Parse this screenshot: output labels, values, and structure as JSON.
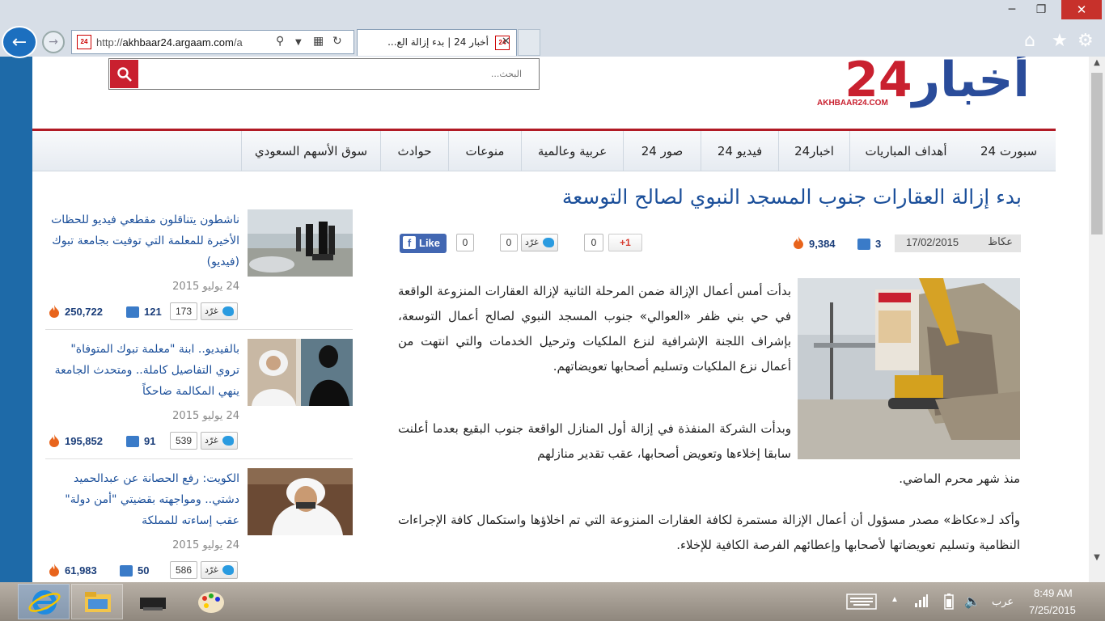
{
  "browser": {
    "url_prefix": "http://",
    "url_domain": "akhbaar24.argaam.com",
    "url_suffix": "/a",
    "tab_title": "أخبار 24 | بدء إزالة الع...",
    "favicon_text": "24"
  },
  "site": {
    "logo_text_blue": "أخبار",
    "logo_text_red": "24",
    "logo_sub": "AKHBAAR24.COM",
    "search_placeholder": "البحث..."
  },
  "nav": {
    "items": [
      {
        "label": "سبورت 24"
      },
      {
        "label": "أهداف المباريات"
      },
      {
        "label": "اخبار24"
      },
      {
        "label": "فيديو 24"
      },
      {
        "label": "صور 24"
      },
      {
        "label": "عربية وعالمية"
      },
      {
        "label": "منوعات"
      },
      {
        "label": "حوادث"
      },
      {
        "label": "سوق الأسهم السعودي"
      }
    ]
  },
  "sidebar": {
    "tweet_label": "غرّد",
    "items": [
      {
        "title": "ناشطون يتناقلون مقطعي فيديو للحظات الأخيرة للمعلمة التي توفيت بجامعة تبوك (فيديو)",
        "date": "24 يوليو 2015",
        "tweets": "173",
        "comments": "121",
        "views": "250,722"
      },
      {
        "title": "بالفيديو.. ابنة \"معلمة تبوك المتوفاة\" تروي التفاصيل كاملة.. ومتحدث الجامعة ينهي المكالمة ضاحكاً",
        "date": "24 يوليو 2015",
        "tweets": "539",
        "comments": "91",
        "views": "195,852"
      },
      {
        "title": "الكويت: رفع الحصانة عن عبدالحميد دشتي.. ومواجهته بقضيتي \"أمن دولة\" عقب إساءته للمملكة",
        "date": "24 يوليو 2015",
        "tweets": "586",
        "comments": "50",
        "views": "61,983"
      }
    ]
  },
  "article": {
    "title": "بدء إزالة العقارات جنوب المسجد النبوي لصالح التوسعة",
    "source": "عكاظ",
    "date": "17/02/2015",
    "comments": "3",
    "views": "9,384",
    "gplus_label": "+1",
    "gplus_count": "0",
    "tweet_label": "غرّد",
    "tweet_count": "0",
    "fb_label": "Like",
    "fb_count": "0",
    "paragraphs": [
      "بدأت أمس أعمال الإزالة ضمن المرحلة الثانية لإزالة العقارات المنزوعة الواقعة في حي بني ظفر «العوالي» جنوب المسجد النبوي لصالح أعمال التوسعة، بإشراف اللجنة الإشرافية لنزع الملكيات وترحيل الخدمات والتي انتهت من أعمال نزع الملكيات وتسليم أصحابها تعويضاتهم.",
      "وبدأت الشركة المنفذة في إزالة أول المنازل الواقعة جنوب البقيع بعدما أعلنت سابقا إخلاءها وتعويض أصحابها، عقب تقدير منازلهم",
      "منذ شهر محرم الماضي.",
      "وأكد لـ«عكاظ» مصدر مسؤول أن أعمال الإزالة مستمرة لكافة العقارات المنزوعة التي تم اخلاؤها واستكمال كافة الإجراءات النظامية وتسليم تعويضاتها لأصحابها وإعطائهم الفرصة الكافية للإخلاء."
    ]
  },
  "taskbar": {
    "language": "عرب",
    "time": "8:49 AM",
    "date": "7/25/2015"
  },
  "colors": {
    "brand_red": "#c9202f",
    "brand_blue": "#2a4c9a",
    "link_blue": "#1b4f9a"
  }
}
